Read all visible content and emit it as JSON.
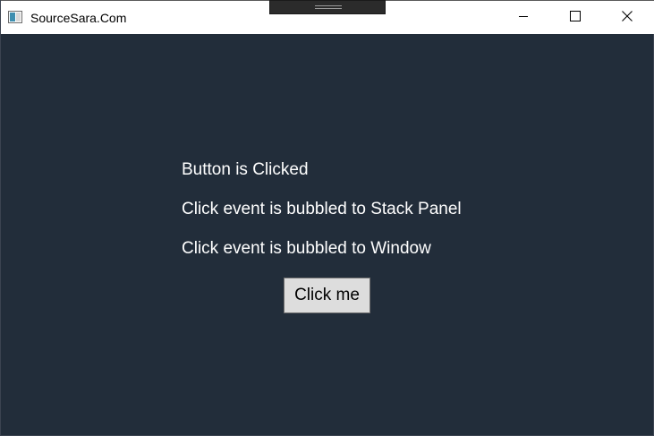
{
  "window": {
    "title": "SourceSara.Com",
    "background_color": "#222d3a",
    "caption_buttons": [
      "minimize-icon",
      "maximize-icon",
      "close-icon"
    ]
  },
  "main": {
    "messages": [
      "Button is Clicked",
      "Click event is bubbled to Stack Panel",
      "Click event is bubbled to Window"
    ],
    "button_label": "Click me"
  }
}
